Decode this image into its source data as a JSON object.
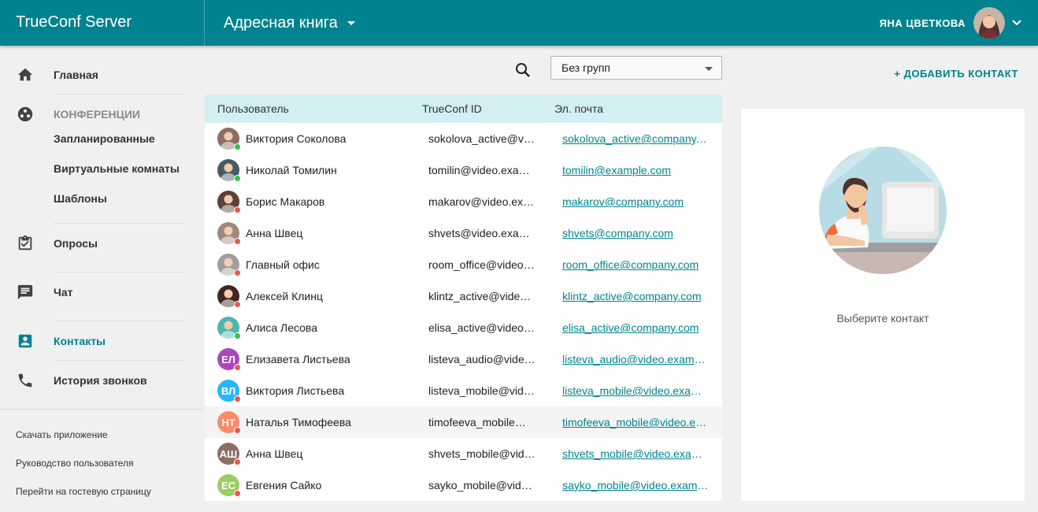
{
  "header": {
    "brand": "TrueConf Server",
    "title": "Адресная книга",
    "user_name": "ЯНА ЦВЕТКОВА"
  },
  "sidebar": {
    "items": [
      {
        "key": "home",
        "label": "Главная"
      },
      {
        "key": "conferences",
        "label": "КОНФЕРЕНЦИИ"
      },
      {
        "key": "scheduled",
        "label": "Запланированные"
      },
      {
        "key": "virtual_rooms",
        "label": "Виртуальные комнаты"
      },
      {
        "key": "templates",
        "label": "Шаблоны"
      },
      {
        "key": "polls",
        "label": "Опросы"
      },
      {
        "key": "chat",
        "label": "Чат"
      },
      {
        "key": "contacts",
        "label": "Контакты"
      },
      {
        "key": "call_history",
        "label": "История звонков"
      }
    ],
    "footer_links": [
      "Скачать приложение",
      "Руководство пользователя",
      "Перейти на гостевую страницу"
    ]
  },
  "toolbar": {
    "group_select_value": "Без групп",
    "add_contact_label": "+ ДОБАВИТЬ КОНТАКТ"
  },
  "table": {
    "columns": [
      "Пользователь",
      "TrueConf ID",
      "Эл. почта"
    ],
    "rows": [
      {
        "name": "Виктория Соколова",
        "id": "sokolova_active@video.example.com",
        "email": "sokolova_active@company.com",
        "status": "online",
        "initials": "",
        "color": "#8d6e63"
      },
      {
        "name": "Николай Томилин",
        "id": "tomilin@video.example.com",
        "email": "tomilin@example.com",
        "status": "online",
        "initials": "",
        "color": "#455a64"
      },
      {
        "name": "Борис Макаров",
        "id": "makarov@video.example.com",
        "email": "makarov@company.com",
        "status": "offline",
        "initials": "",
        "color": "#5d4037"
      },
      {
        "name": "Анна Швец",
        "id": "shvets@video.example.com",
        "email": "shvets@company.com",
        "status": "offline",
        "initials": "",
        "color": "#a1887f"
      },
      {
        "name": "Главный офис",
        "id": "room_office@video.example.com",
        "email": "room_office@company.com",
        "status": "offline",
        "initials": "",
        "color": "#9e9e9e"
      },
      {
        "name": "Алексей Клинц",
        "id": "klintz_active@video.example.com",
        "email": "klintz_active@company.com",
        "status": "offline",
        "initials": "",
        "color": "#3e2723"
      },
      {
        "name": "Алиса Лесова",
        "id": "elisa_active@video.example.com",
        "email": "elisa_active@company.com",
        "status": "online",
        "initials": "",
        "color": "#4db6ac"
      },
      {
        "name": "Елизавета Листьева",
        "id": "listeva_audio@video.example.com",
        "email": "listeva_audio@video.example.com",
        "status": "offline",
        "initials": "ЕЛ",
        "color": "#ab47bc"
      },
      {
        "name": "Виктория Листьева",
        "id": "listeva_mobile@video.example.com",
        "email": "listeva_mobile@video.example.com",
        "status": "offline",
        "initials": "ВЛ",
        "color": "#29b6f6"
      },
      {
        "name": "Наталья Тимофеева",
        "id": "timofeeva_mobile@video.example.com",
        "email": "timofeeva_mobile@video.example.com",
        "status": "offline",
        "initials": "НТ",
        "color": "#ff8a65"
      },
      {
        "name": "Анна Швец",
        "id": "shvets_mobile@video.example.com",
        "email": "shvets_mobile@video.example.com",
        "status": "offline",
        "initials": "АШ",
        "color": "#8d6e63"
      },
      {
        "name": "Евгения Сайко",
        "id": "sayko_mobile@video.example.com",
        "email": "sayko_mobile@video.example.com",
        "status": "offline",
        "initials": "ЕС",
        "color": "#9ccc65"
      }
    ]
  },
  "detail": {
    "empty_text": "Выберите контакт"
  },
  "colors": {
    "accent": "#00838f",
    "table_header": "#d2eff3",
    "online": "#27c93f",
    "offline": "#ef5350"
  }
}
